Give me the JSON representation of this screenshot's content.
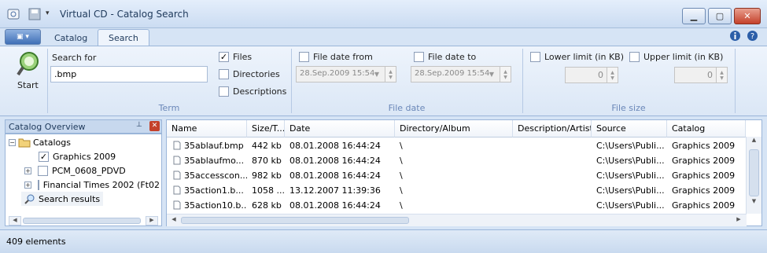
{
  "window": {
    "title": "Virtual CD - Catalog Search",
    "minimize_glyph": "▁",
    "maximize_glyph": "▢",
    "close_glyph": "✕"
  },
  "ribbon": {
    "tabs": [
      {
        "label": "Catalog",
        "active": false
      },
      {
        "label": "Search",
        "active": true
      }
    ],
    "start_label": "Start",
    "search_for_label": "Search for",
    "search_value": ".bmp",
    "files_label": "Files",
    "files_checked": true,
    "directories_label": "Directories",
    "directories_checked": false,
    "descriptions_label": "Descriptions",
    "descriptions_checked": false,
    "file_date_from_label": "File date from",
    "file_date_from_value": "28.Sep.2009 15:54",
    "file_date_to_label": "File date to",
    "file_date_to_value": "28.Sep.2009 15:54",
    "lower_limit_label": "Lower limit (in KB)",
    "lower_limit_value": "0",
    "upper_limit_label": "Upper limit (in KB)",
    "upper_limit_value": "0",
    "groups": {
      "term": "Term",
      "file_date": "File date",
      "file_size": "File size"
    }
  },
  "catalog_overview": {
    "title": "Catalog Overview",
    "tree": [
      {
        "label": "Catalogs",
        "level": 0
      },
      {
        "label": "Graphics 2009",
        "level": 1,
        "checked": true
      },
      {
        "label": "PCM_0608_PDVD",
        "level": 1,
        "checked": false
      },
      {
        "label": "Financial Times 2002 (Ft02",
        "level": 1,
        "checked": false
      },
      {
        "label": "Search results",
        "level": 0
      }
    ]
  },
  "results": {
    "columns": [
      "Name",
      "Size/T...",
      "Date",
      "Directory/Album",
      "Description/Artist",
      "Source",
      "Catalog"
    ],
    "rows": [
      {
        "name": "35ablauf.bmp",
        "size": "442 kb",
        "date": "08.01.2008 16:44:24",
        "directory": "\\",
        "description": "",
        "source": "C:\\Users\\Publi...",
        "catalog": "Graphics 2009"
      },
      {
        "name": "35ablaufmo...",
        "size": "870 kb",
        "date": "08.01.2008 16:44:24",
        "directory": "\\",
        "description": "",
        "source": "C:\\Users\\Publi...",
        "catalog": "Graphics 2009"
      },
      {
        "name": "35accesscon...",
        "size": "982 kb",
        "date": "08.01.2008 16:44:24",
        "directory": "\\",
        "description": "",
        "source": "C:\\Users\\Publi...",
        "catalog": "Graphics 2009"
      },
      {
        "name": "35action1.b...",
        "size": "1058 ...",
        "date": "13.12.2007 11:39:36",
        "directory": "\\",
        "description": "",
        "source": "C:\\Users\\Publi...",
        "catalog": "Graphics 2009"
      },
      {
        "name": "35action10.b...",
        "size": "628 kb",
        "date": "08.01.2008 16:44:24",
        "directory": "\\",
        "description": "",
        "source": "C:\\Users\\Publi...",
        "catalog": "Graphics 2009"
      }
    ]
  },
  "status": {
    "text": "409 elements"
  }
}
